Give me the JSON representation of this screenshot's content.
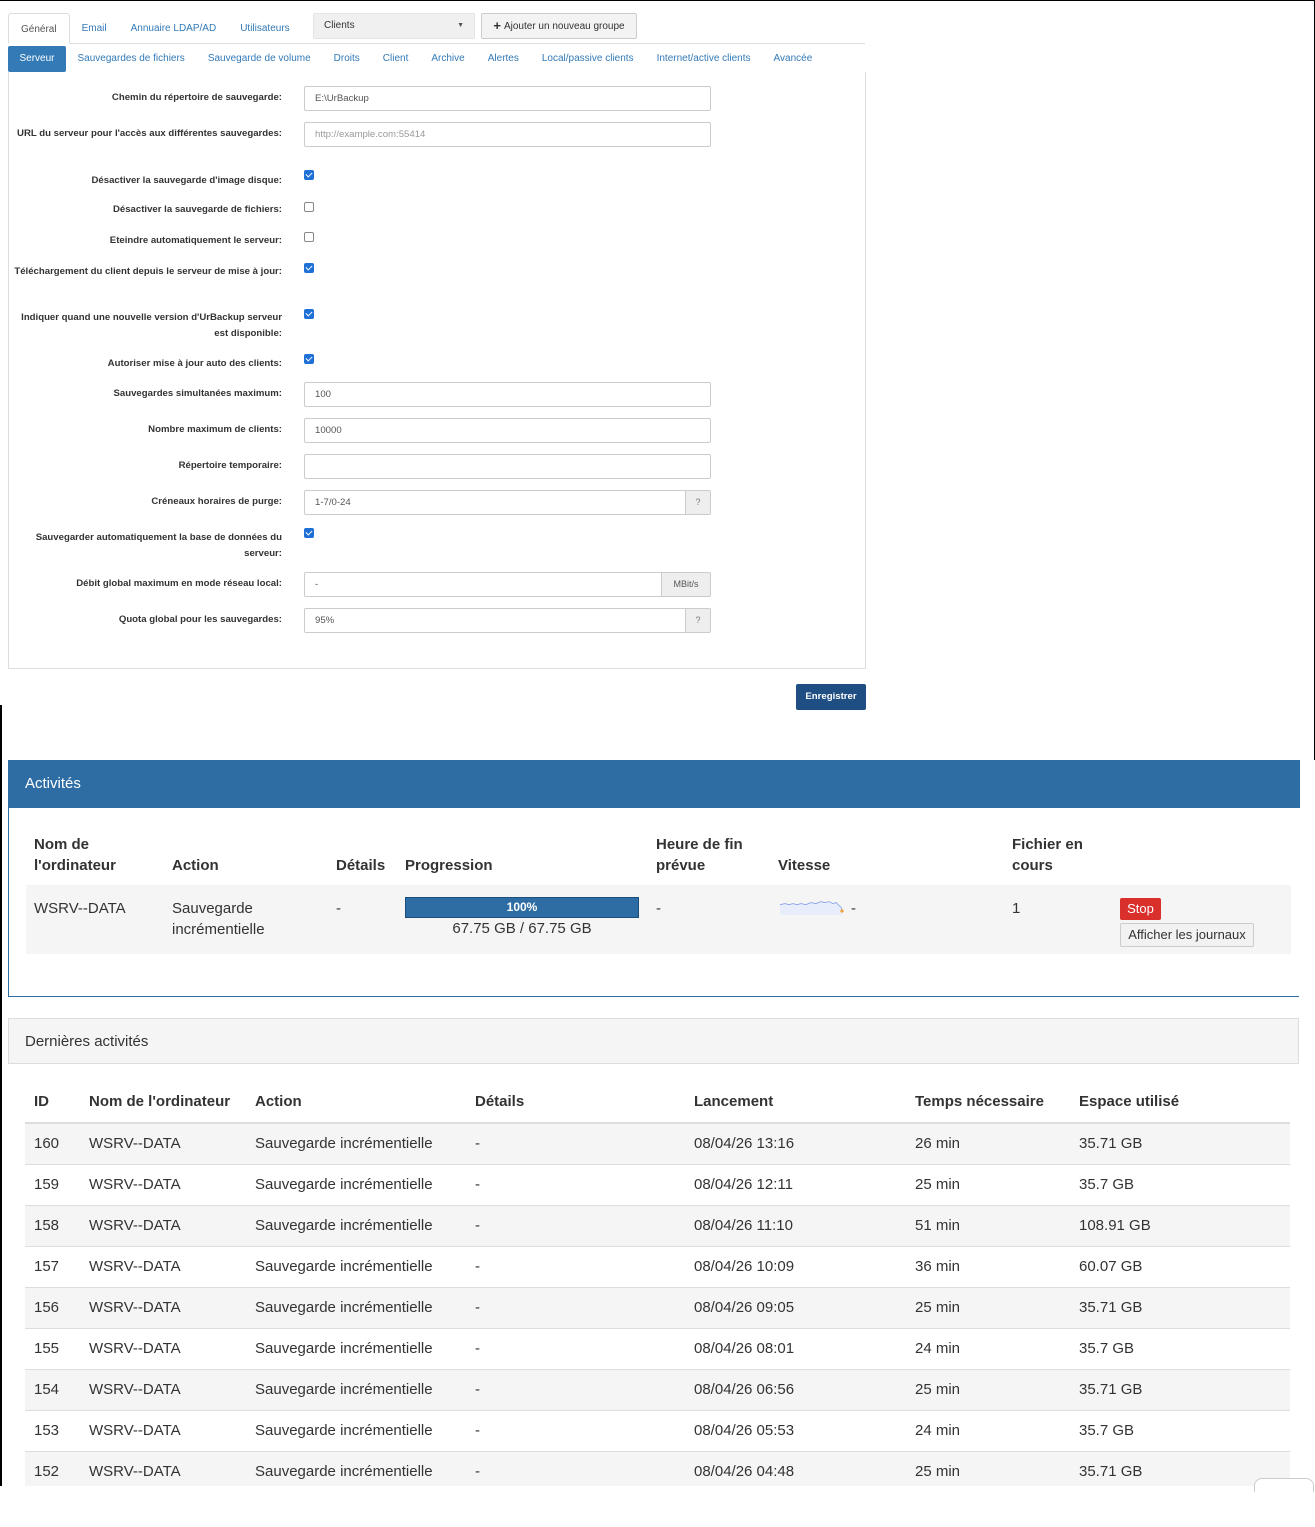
{
  "settings": {
    "top_tabs": [
      "Général",
      "Email",
      "Annuaire LDAP/AD",
      "Utilisateurs"
    ],
    "group_select": "Clients",
    "add_group_label": "Ajouter un nouveau groupe",
    "sub_tabs": [
      "Serveur",
      "Sauvegardes de fichiers",
      "Sauvegarde de volume",
      "Droits",
      "Client",
      "Archive",
      "Alertes",
      "Local/passive clients",
      "Internet/active clients",
      "Avancée"
    ],
    "fields": [
      {
        "label": "Chemin du répertoire de sauvegarde:",
        "type": "text",
        "value": "E:\\UrBackup"
      },
      {
        "label": "URL du serveur pour l'accès aux différentes sauvegardes:",
        "type": "text",
        "placeholder": "http://example.com:55414"
      },
      {
        "label": "Désactiver la sauvegarde d'image disque:",
        "type": "checkbox",
        "checked": true
      },
      {
        "label": "Désactiver la sauvegarde de fichiers:",
        "type": "checkbox",
        "checked": false
      },
      {
        "label": "Eteindre automatiquement le serveur:",
        "type": "checkbox",
        "checked": false
      },
      {
        "label": "Téléchargement du client depuis le serveur de mise à jour:",
        "type": "checkbox",
        "checked": true
      },
      {
        "label": "Indiquer quand une nouvelle version d'UrBackup serveur est disponible:",
        "type": "checkbox",
        "checked": true
      },
      {
        "label": "Autoriser mise à jour auto des clients:",
        "type": "checkbox",
        "checked": true
      },
      {
        "label": "Sauvegardes simultanées maximum:",
        "type": "text",
        "value": "100"
      },
      {
        "label": "Nombre maximum de clients:",
        "type": "text",
        "value": "10000"
      },
      {
        "label": "Répertoire temporaire:",
        "type": "text",
        "value": ""
      },
      {
        "label": "Créneaux horaires de purge:",
        "type": "text",
        "value": "1-7/0-24",
        "addon": "?"
      },
      {
        "label": "Sauvegarder automatiquement la base de données du serveur:",
        "type": "checkbox",
        "checked": true
      },
      {
        "label": "Débit global maximum en mode réseau local:",
        "type": "text",
        "value": "-",
        "addon": "MBit/s"
      },
      {
        "label": "Quota global pour les sauvegardes:",
        "type": "text",
        "value": "95%",
        "addon": "?"
      }
    ],
    "save_label": "Enregistrer"
  },
  "activities": {
    "title": "Activités",
    "headers": {
      "computer": [
        "Nom de",
        "l'ordinateur"
      ],
      "action": "Action",
      "details": "Détails",
      "progress": "Progression",
      "eta": [
        "Heure de fin",
        "prévue"
      ],
      "speed": "Vitesse",
      "current_file": [
        "Fichier en",
        "cours"
      ]
    },
    "row": {
      "computer": "WSRV--DATA",
      "action": [
        "Sauvegarde",
        "incrémentielle"
      ],
      "details": "-",
      "progress_percent": 100,
      "progress_label": "100%",
      "progress_text": "67.75 GB / 67.75 GB",
      "eta": "-",
      "speed": "-",
      "current_file": "1",
      "stop_label": "Stop",
      "logs_label": "Afficher les journaux"
    }
  },
  "last_activities": {
    "title": "Dernières activités",
    "columns": [
      "ID",
      "Nom de l'ordinateur",
      "Action",
      "Détails",
      "Lancement",
      "Temps nécessaire",
      "Espace utilisé"
    ],
    "rows": [
      [
        "160",
        "WSRV--DATA",
        "Sauvegarde incrémentielle",
        "-",
        "08/04/26 13:16",
        "26 min",
        "35.71 GB"
      ],
      [
        "159",
        "WSRV--DATA",
        "Sauvegarde incrémentielle",
        "-",
        "08/04/26 12:11",
        "25 min",
        "35.7 GB"
      ],
      [
        "158",
        "WSRV--DATA",
        "Sauvegarde incrémentielle",
        "-",
        "08/04/26 11:10",
        "51 min",
        "108.91 GB"
      ],
      [
        "157",
        "WSRV--DATA",
        "Sauvegarde incrémentielle",
        "-",
        "08/04/26 10:09",
        "36 min",
        "60.07 GB"
      ],
      [
        "156",
        "WSRV--DATA",
        "Sauvegarde incrémentielle",
        "-",
        "08/04/26 09:05",
        "25 min",
        "35.71 GB"
      ],
      [
        "155",
        "WSRV--DATA",
        "Sauvegarde incrémentielle",
        "-",
        "08/04/26 08:01",
        "24 min",
        "35.7 GB"
      ],
      [
        "154",
        "WSRV--DATA",
        "Sauvegarde incrémentielle",
        "-",
        "08/04/26 06:56",
        "25 min",
        "35.71 GB"
      ],
      [
        "153",
        "WSRV--DATA",
        "Sauvegarde incrémentielle",
        "-",
        "08/04/26 05:53",
        "24 min",
        "35.7 GB"
      ],
      [
        "152",
        "WSRV--DATA",
        "Sauvegarde incrémentielle",
        "-",
        "08/04/26 04:48",
        "25 min",
        "35.71 GB"
      ]
    ]
  },
  "colors": {
    "primary": "#337ab7",
    "panel_header": "#2e6da4",
    "danger": "#d9302c",
    "save_button": "#1f4e82",
    "checkbox": "#1e6fd6"
  }
}
